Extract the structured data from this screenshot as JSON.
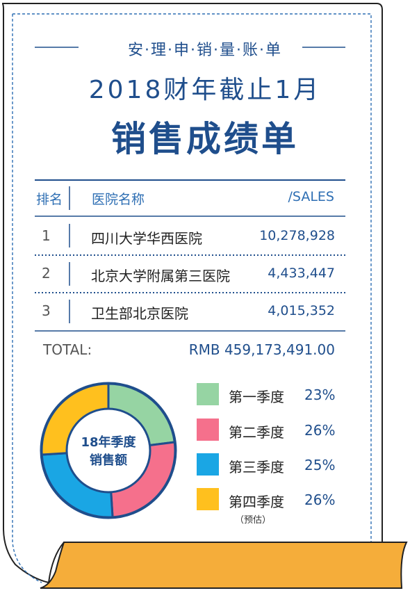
{
  "header": {
    "small_title": "安·理·申·销·量·账·单",
    "subtitle": "2018财年截止1月",
    "title": "销售成绩单"
  },
  "table": {
    "columns": [
      "排名",
      "医院名称",
      "/SALES"
    ],
    "rows": [
      {
        "rank": "1",
        "hospital": "四川大学华西医院",
        "sales": "10,278,928"
      },
      {
        "rank": "2",
        "hospital": "北京大学附属第三医院",
        "sales": "4,433,447"
      },
      {
        "rank": "3",
        "hospital": "卫生部北京医院",
        "sales": "4,015,352"
      }
    ],
    "total_label": "TOTAL:",
    "total_value": "RMB 459,173,491.00"
  },
  "chart_data": {
    "type": "pie",
    "title": "18年季度销售额",
    "title_lines": [
      "18年季度",
      "销售额"
    ],
    "categories": [
      "第一季度",
      "第二季度",
      "第三季度",
      "第四季度"
    ],
    "values": [
      23,
      26,
      25,
      26
    ],
    "labels": [
      "23%",
      "26%",
      "25%",
      "26%"
    ],
    "colors": [
      "#96d4a3",
      "#f5708c",
      "#1aa6e4",
      "#ffc01e"
    ],
    "annotations": [
      {
        "category": "第四季度",
        "text": "（预估）"
      }
    ],
    "legend_position": "right"
  }
}
